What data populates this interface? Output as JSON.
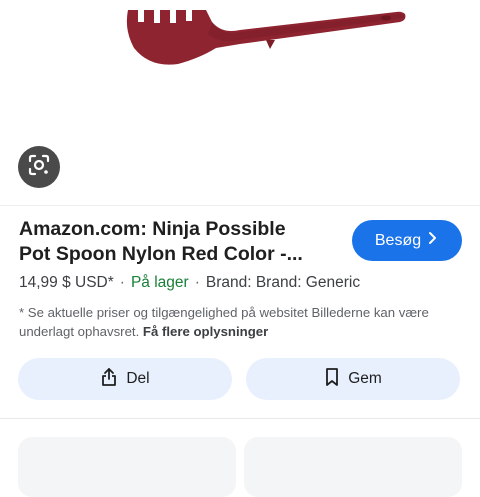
{
  "result": {
    "title": "Amazon.com: Ninja Possible Pot Spoon Nylon Red Color -...",
    "visit_label": "Besøg",
    "price": "14,99 $ USD*",
    "separator": "·",
    "stock_status": "På lager",
    "brand": "Brand: Brand: Generic",
    "disclaimer": "* Se aktuelle priser og tilgængelighed på websitet Billederne kan være underlagt ophavsret.",
    "more_info": "Få flere oplysninger"
  },
  "actions": {
    "share_label": "Del",
    "save_label": "Gem"
  },
  "icons": {
    "lens": "google-lens-icon",
    "visit": "chevron-right-icon",
    "share": "share-icon",
    "save": "bookmark-icon"
  },
  "colors": {
    "accent": "#1a73e8",
    "stock": "#188038",
    "action_bg": "#e8f0fe",
    "product": "#8f2431"
  }
}
